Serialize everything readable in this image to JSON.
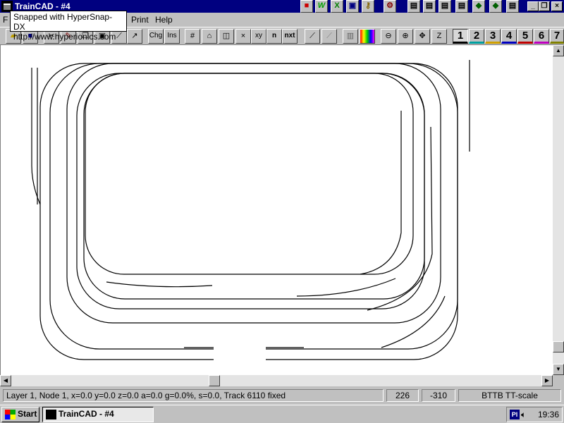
{
  "window": {
    "title": "TrainCAD - #4"
  },
  "tooltip": {
    "line1": "Snapped with HyperSnap-DX",
    "line2": "http://www.hyperionics.com"
  },
  "menu": {
    "file_partial": "F",
    "print": "Print",
    "help": "Help"
  },
  "toolbar": {
    "change_label": "Chg",
    "insert_label": "Ins",
    "delete_label": "×",
    "xy_label": "xy",
    "n_label": "n",
    "nxt_label": "nxt",
    "layers": [
      "1",
      "2",
      "3",
      "4",
      "5",
      "6",
      "7"
    ],
    "layer_colors": [
      "#000000",
      "#00a0a0",
      "#d0a000",
      "#0000c0",
      "#c00000",
      "#c000c0",
      "#808000"
    ],
    "active_layer": "1"
  },
  "status": {
    "info": "Layer 1, Node 1, x=0.0 y=0.0 z=0.0 a=0.0 g=0.0%, s=0.0, Track 6110  fixed",
    "x": "226",
    "y": "-310",
    "scale": "BTTB TT-scale"
  },
  "taskbar": {
    "start": "Start",
    "task": "TrainCAD - #4",
    "tray_pl": "Pl",
    "clock": "19:36"
  },
  "icons": {
    "open": "folder-open-icon",
    "save": "floppy-save-icon",
    "cut": "scissors-icon",
    "zoom_out": "zoom-out-icon",
    "zoom_in": "zoom-in-icon",
    "pan": "pan-arrows-icon"
  }
}
